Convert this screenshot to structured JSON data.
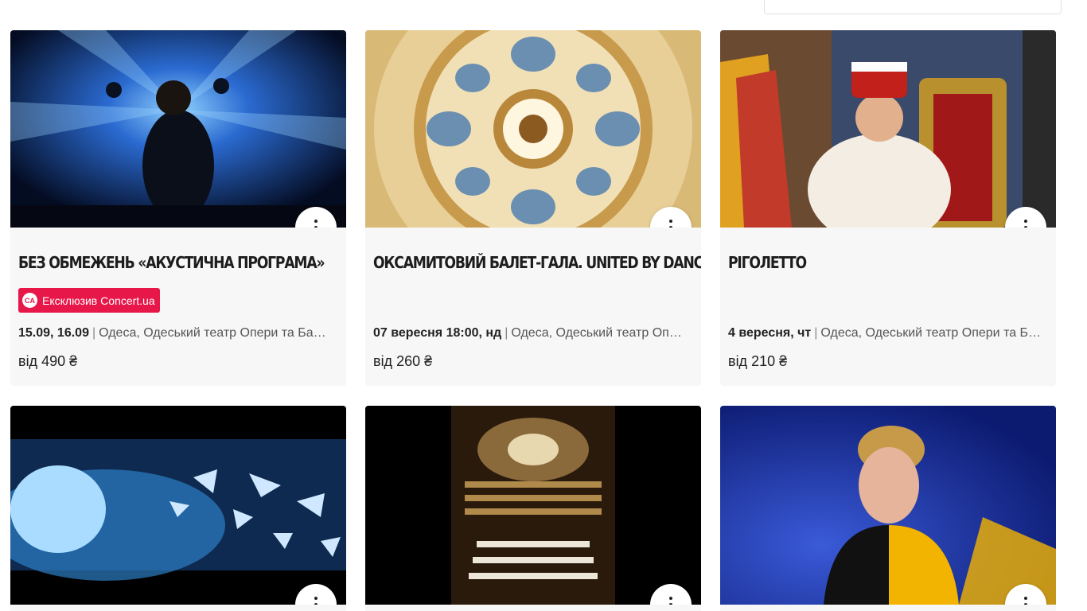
{
  "events": [
    {
      "title": "БЕЗ ОБМЕЖЕНЬ «АКУСТИЧНА ПРОГРАМА»",
      "badge": "Ексклюзив Concert.ua",
      "date": "15.09, 16.09",
      "venue": "Одеса, Одеський театр Опери та Балету",
      "price": "від 490 ₴",
      "image_colors": [
        "#0a1a3a",
        "#2e6fd0"
      ]
    },
    {
      "title": "ОКСАМИТОВИЙ БАЛЕТ-ГАЛА. UNITED BY DANCE",
      "badge": "",
      "date": "07 вересня 18:00, нд",
      "venue": "Одеса, Одеський театр Опери та Балету",
      "price": "від 260 ₴",
      "image_colors": [
        "#c9a25a",
        "#f0dcae"
      ]
    },
    {
      "title": "РІГОЛЕТТО",
      "badge": "",
      "date": "4 вересня, чт",
      "venue": "Одеса, Одеський театр Опери та Балету",
      "price": "від 210 ₴",
      "image_colors": [
        "#5a3a2a",
        "#b22222"
      ]
    },
    {
      "image_colors": [
        "#0b1e3c",
        "#4fa3d8"
      ]
    },
    {
      "image_colors": [
        "#000000",
        "#6b4a24"
      ]
    },
    {
      "image_colors": [
        "#1b2fa8",
        "#f2b400"
      ]
    }
  ],
  "badge_icon": "CA",
  "more_icon": "more-vertical-icon",
  "accent_color": "#e8174a"
}
